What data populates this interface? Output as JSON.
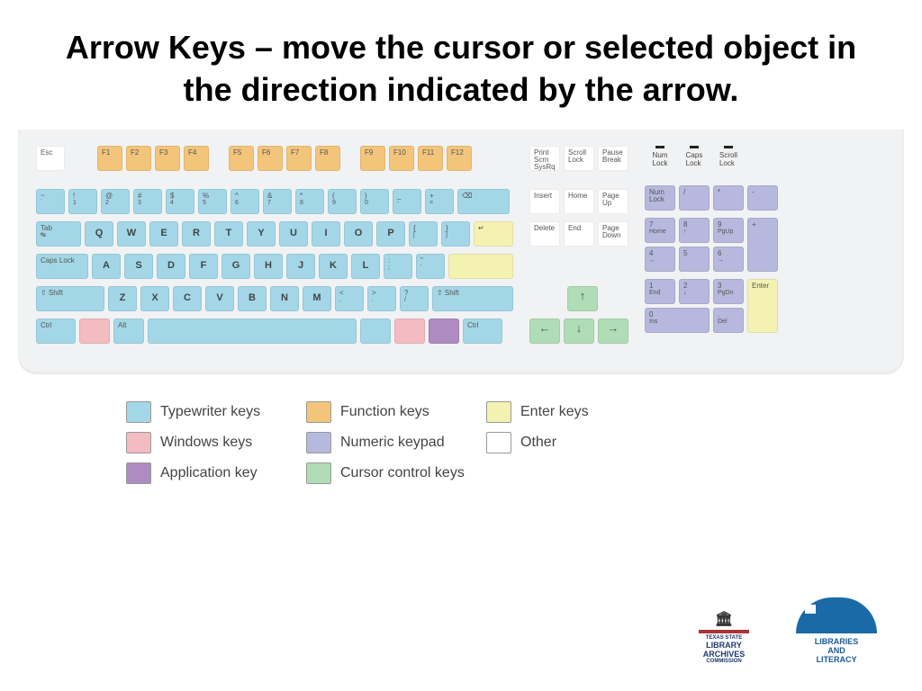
{
  "title": "Arrow Keys – move the cursor or selected object in the direction indicated by the arrow.",
  "legend": {
    "typewriter": "Typewriter keys",
    "function": "Function keys",
    "enter": "Enter keys",
    "windows": "Windows keys",
    "numeric": "Numeric keypad",
    "other": "Other",
    "application": "Application key",
    "cursor": "Cursor control keys"
  },
  "keys": {
    "esc": "Esc",
    "f": [
      "F1",
      "F2",
      "F3",
      "F4",
      "F5",
      "F6",
      "F7",
      "F8",
      "F9",
      "F10",
      "F11",
      "F12"
    ],
    "print": "Print\nScrn\nSysRq",
    "scroll": "Scroll\nLock",
    "pause": "Pause\nBreak",
    "indicators": [
      "Num\nLock",
      "Caps\nLock",
      "Scroll\nLock"
    ],
    "numrow_top": [
      "~",
      "!",
      "@",
      "#",
      "$",
      "%",
      "^",
      "&",
      "*",
      "(",
      ")",
      "_",
      "+"
    ],
    "numrow_bot": [
      "`",
      "1",
      "2",
      "3",
      "4",
      "5",
      "6",
      "7",
      "8",
      "9",
      "0",
      "-",
      "="
    ],
    "tab": "Tab",
    "qwerty": [
      "Q",
      "W",
      "E",
      "R",
      "T",
      "Y",
      "U",
      "I",
      "O",
      "P"
    ],
    "brackets_top": [
      "{",
      "}"
    ],
    "brackets_bot": [
      "[",
      "]"
    ],
    "caps": "Caps\nLock",
    "asdf": [
      "A",
      "S",
      "D",
      "F",
      "G",
      "H",
      "J",
      "K",
      "L"
    ],
    "semi_top": ":",
    "semi_bot": ";",
    "quote_top": "\"",
    "quote_bot": "'",
    "shift": "Shift",
    "zxcv": [
      "Z",
      "X",
      "C",
      "V",
      "B",
      "N",
      "M"
    ],
    "lt_top": "<",
    "lt_bot": ",",
    "gt_top": ">",
    "gt_bot": ".",
    "q_top": "?",
    "q_bot": "/",
    "ctrl": "Ctrl",
    "alt": "Alt",
    "nav": [
      "Insert",
      "Home",
      "Page\nUp",
      "Delete",
      "End",
      "Page\nDown"
    ],
    "arrows": [
      "↑",
      "←",
      "↓",
      "→"
    ],
    "numpad": {
      "numlock": "Num\nLock",
      "div": "/",
      "mul": "*",
      "sub": "-",
      "7": "7",
      "7s": "Home",
      "8": "8",
      "8s": "↑",
      "9": "9",
      "9s": "PgUp",
      "add": "+",
      "4": "4",
      "4s": "←",
      "5": "5",
      "6": "6",
      "6s": "→",
      "1": "1",
      "1s": "End",
      "2": "2",
      "2s": "↓",
      "3": "3",
      "3s": "PgDn",
      "enter": "Enter",
      "0": "0",
      "0s": "Ins",
      "dot": ".",
      "dots": "Del"
    }
  },
  "logos": {
    "library": "LIBRARY",
    "archives": "ARCHIVES",
    "texas": "TEXAS STATE",
    "commission": "COMMISSION",
    "literacy": "LIBRARIES\nAND\nLITERACY"
  }
}
